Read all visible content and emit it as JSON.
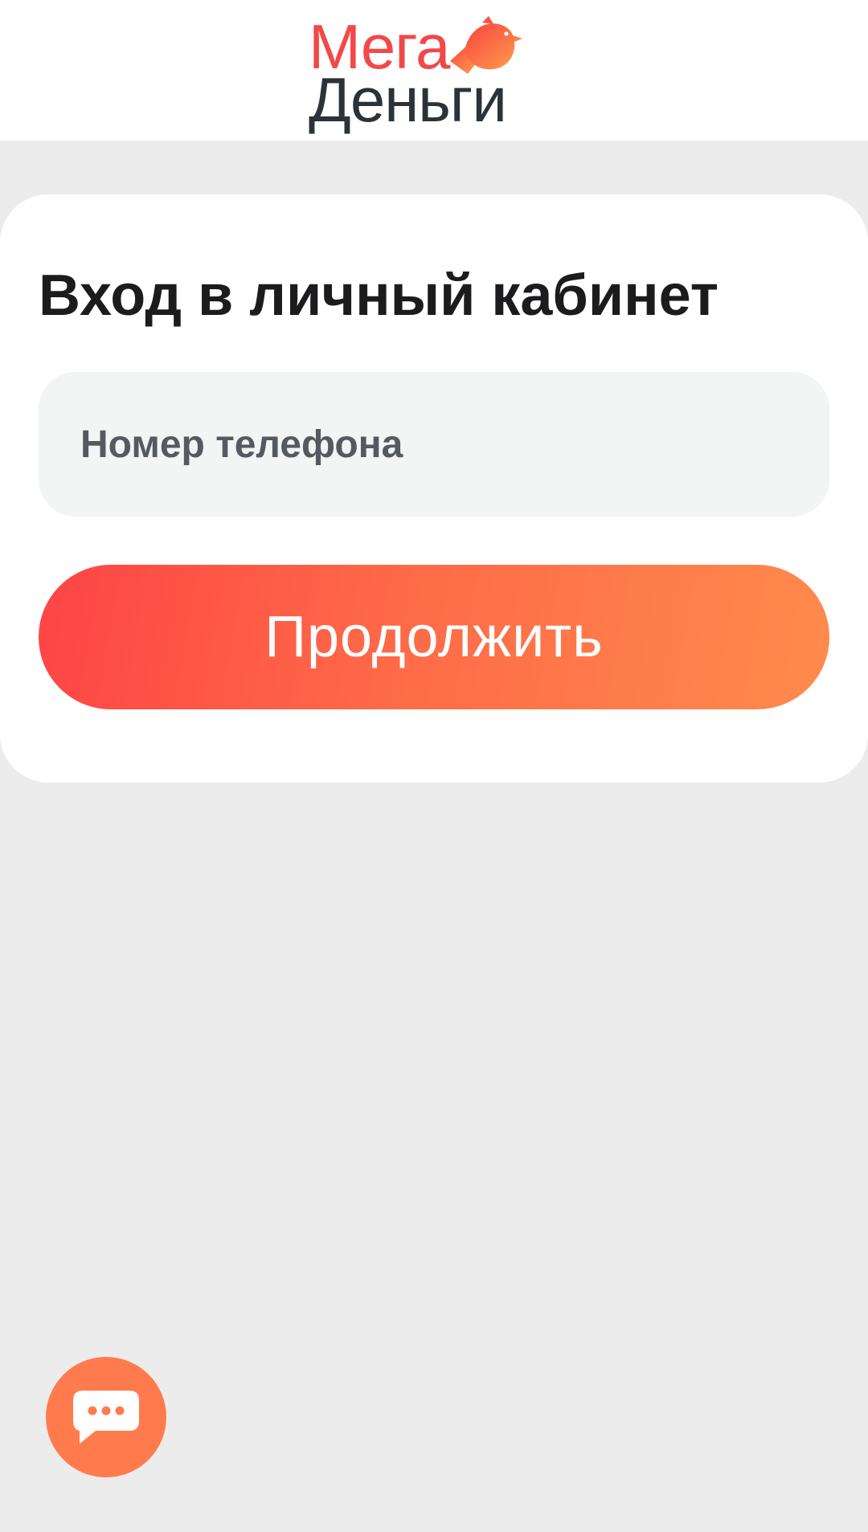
{
  "brand": {
    "logo_line1": "Мега",
    "logo_line2": "Деньги",
    "logo_icon": "bird-icon",
    "colors": {
      "accent_red": "#f34848",
      "accent_orange": "#ff8b4c",
      "dark_text": "#2c3338"
    }
  },
  "login": {
    "title": "Вход в личный кабинет",
    "phone_placeholder": "Номер телефона",
    "phone_value": "",
    "continue_label": "Продолжить"
  },
  "chat": {
    "icon": "chat-bubble-icon",
    "color": "#ff7b4d"
  }
}
